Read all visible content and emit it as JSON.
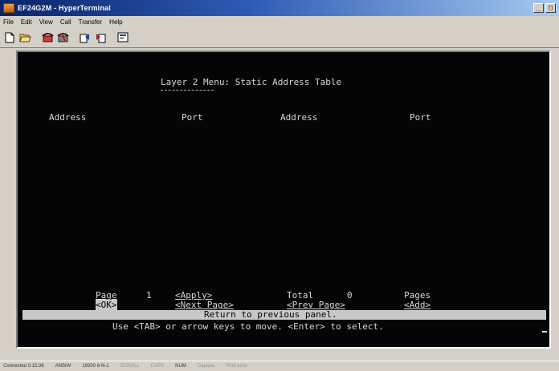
{
  "window": {
    "title": "EF24G2M - HyperTerminal",
    "min_label": "_",
    "close_label": "□"
  },
  "menu": [
    {
      "label": "File"
    },
    {
      "label": "Edit"
    },
    {
      "label": "View"
    },
    {
      "label": "Call"
    },
    {
      "label": "Transfer"
    },
    {
      "label": "Help"
    }
  ],
  "toolbar": {
    "icons": [
      "new-icon",
      "open-icon",
      "phone-icon",
      "disconnect-icon",
      "send-icon",
      "receive-icon",
      "properties-icon"
    ]
  },
  "terminal": {
    "heading": "Layer 2 Menu: Static Address Table",
    "columns": [
      "Address",
      "Port",
      "Address",
      "Port"
    ],
    "page_label": "Page",
    "page_value": "1",
    "apply_label": "<Apply>",
    "total_label": "Total",
    "total_value": "0",
    "pages_label": "Pages",
    "ok_label": "<OK>",
    "next_page_label": "<Next Page>",
    "prev_page_label": "<Prev Page>",
    "add_label": "<Add>",
    "status_message": "Return to previous panel.",
    "help_line": "Use <TAB> or arrow keys to move. <Enter> to select."
  },
  "statusbar": {
    "cells": [
      "Connected 0:15:36",
      "ANSIW",
      "19200 8-N-1",
      "SCROLL",
      "CAPS",
      "NUM",
      "Capture",
      "Print echo"
    ]
  },
  "colors": {
    "terminal_bg": "#050505",
    "terminal_fg": "#d8d8d8",
    "title_gradient_start": "#0a246a"
  }
}
